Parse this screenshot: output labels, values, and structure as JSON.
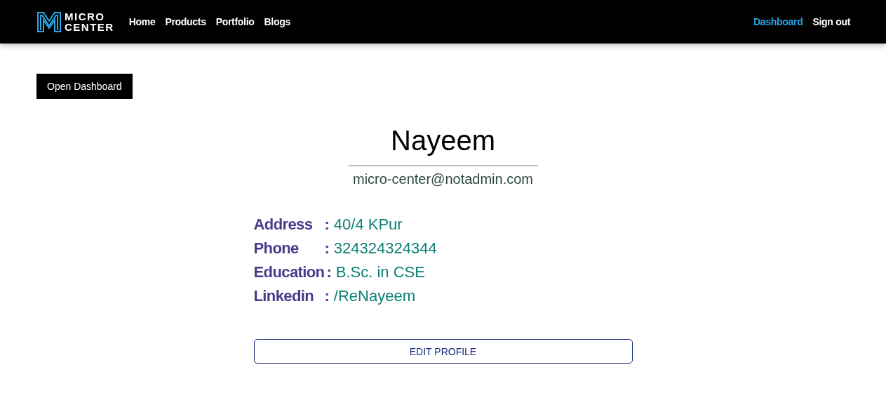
{
  "navbar": {
    "logo": {
      "line_1": "MICRO",
      "line_2": "CENTER"
    },
    "links": [
      {
        "label": "Home",
        "selected": false
      },
      {
        "label": "Products",
        "selected": false
      },
      {
        "label": "Portfolio",
        "selected": false
      },
      {
        "label": "Blogs",
        "selected": false
      }
    ],
    "right_links": [
      {
        "label": "Dashboard",
        "selected": true
      },
      {
        "label": "Sign out",
        "selected": false
      }
    ]
  },
  "open_dashboard_button": "Open Dashboard",
  "profile": {
    "name": "Nayeem",
    "email": "micro-center@notadmin.com",
    "fields": [
      {
        "label": "Address",
        "separator": ":",
        "value": "40/4 KPur"
      },
      {
        "label": "Phone",
        "separator": ":",
        "value": "324324324344"
      },
      {
        "label": "Education",
        "separator": ":",
        "value": "B.Sc. in CSE"
      },
      {
        "label": "Linkedin",
        "separator": ":",
        "value": "/ReNayeem"
      }
    ],
    "edit_button": "EDIT PROFILE"
  }
}
